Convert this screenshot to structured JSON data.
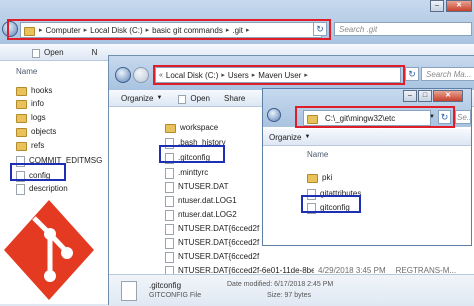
{
  "window1": {
    "address": {
      "segments": [
        "Computer",
        "Local Disk (C:)",
        "basic git commands",
        ".git"
      ]
    },
    "search_placeholder": "Search .git",
    "toolbar": {
      "open_label": "Open",
      "new_label": "N"
    },
    "header": {
      "name_col": "Name"
    },
    "files": [
      "hooks",
      "info",
      "logs",
      "objects",
      "refs",
      "COMMIT_EDITMSG",
      "config",
      "description"
    ]
  },
  "window2": {
    "address": {
      "segments": [
        "Local Disk (C:)",
        "Users",
        "Maven User"
      ]
    },
    "search_placeholder": "Search Ma...",
    "toolbar": {
      "organize_label": "Organize",
      "open_label": "Open",
      "share_label": "Share"
    },
    "files": [
      "workspace",
      ".bash_history",
      ".gitconfig",
      ".minttyrc",
      "NTUSER.DAT",
      "ntuser.dat.LOG1",
      "ntuser.dat.LOG2",
      "NTUSER.DAT{6cced2f",
      "NTUSER.DAT{6cced2f",
      "NTUSER.DAT{6cced2f",
      "NTUSER.DAT{6cced2f-6e01-11de-8bed-..."
    ],
    "row_extra": {
      "date": "4/29/2018 3:45 PM",
      "type": "REGTRANS-M..."
    },
    "status": {
      "name": ".gitconfig",
      "type": "GITCONFIG File",
      "date_modified": "Date modified: 6/17/2018 2:45 PM",
      "size": "Size: 97 bytes"
    }
  },
  "window3": {
    "address": {
      "path": "C:\\_git\\mingw32\\etc"
    },
    "search_placeholder": "Se...",
    "toolbar": {
      "organize_label": "Organize"
    },
    "header": {
      "name_col": "Name"
    },
    "files": [
      "pki",
      "gitattributes",
      "gitconfig"
    ]
  },
  "logo": {
    "bg": "#e43a22"
  }
}
